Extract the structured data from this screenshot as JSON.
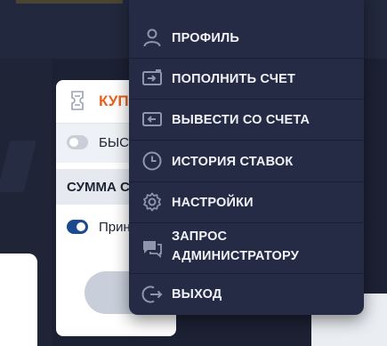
{
  "coupon": {
    "title": "КУПОН",
    "fast_label": "БЫСТРАЯ СТАВКА",
    "sum_label": "СУММА СТАВКИ",
    "accept_label": "Принимать изменения"
  },
  "menu": {
    "items": [
      {
        "icon": "user-icon",
        "label": "ПРОФИЛЬ"
      },
      {
        "icon": "deposit-icon",
        "label": "ПОПОЛНИТЬ СЧЕТ"
      },
      {
        "icon": "withdraw-icon",
        "label": "ВЫВЕСТИ СО СЧЕТА"
      },
      {
        "icon": "history-icon",
        "label": "ИСТОРИЯ СТАВОК"
      },
      {
        "icon": "gear-icon",
        "label": "НАСТРОЙКИ"
      },
      {
        "icon": "chat-icon",
        "label_line1": "ЗАПРОС",
        "label_line2": "АДМИНИСТРАТОРУ"
      },
      {
        "icon": "logout-icon",
        "label": "ВЫХОД"
      }
    ]
  },
  "colors": {
    "background": "#1c2133",
    "menu": "#262b45",
    "accent": "#e8601c",
    "toggle_on": "#1b4a8e"
  }
}
